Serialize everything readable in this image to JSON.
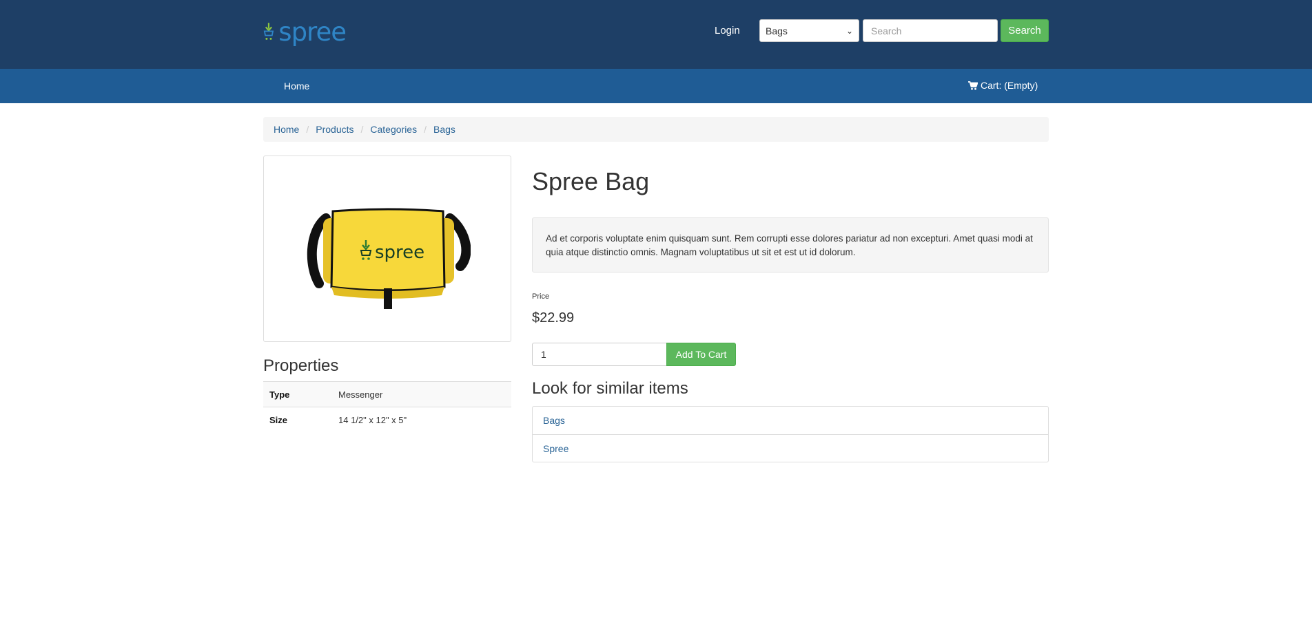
{
  "header": {
    "logo_text": "spree",
    "login_label": "Login",
    "taxon_select_value": "Bags",
    "search_placeholder": "Search",
    "search_button_label": "Search"
  },
  "nav": {
    "home_label": "Home",
    "cart_label": "Cart: (Empty)"
  },
  "breadcrumb": [
    "Home",
    "Products",
    "Categories",
    "Bags"
  ],
  "product": {
    "title": "Spree Bag",
    "description": "Ad et corporis voluptate enim quisquam sunt. Rem corrupti esse dolores pariatur ad non excepturi. Amet quasi modi at quia atque distinctio omnis. Magnam voluptatibus ut sit et est ut id dolorum.",
    "price_label": "Price",
    "price": "$22.99",
    "quantity": "1",
    "add_to_cart_label": "Add To Cart",
    "image_logo_text": "spree"
  },
  "properties": {
    "title": "Properties",
    "rows": [
      {
        "key": "Type",
        "value": "Messenger"
      },
      {
        "key": "Size",
        "value": "14 1/2\" x 12\" x 5\""
      }
    ]
  },
  "similar": {
    "title": "Look for similar items",
    "items": [
      "Bags",
      "Spree"
    ]
  },
  "colors": {
    "header_bg": "#1e3f66",
    "nav_bg": "#1f5c95",
    "accent_green": "#5cb85c",
    "link": "#2a6496",
    "logo_blue": "#2f85c6",
    "logo_green": "#8dc63f",
    "bag_yellow": "#f7d83a"
  },
  "icons": {
    "logo": "spree-logo-icon",
    "cart": "shopping-cart-icon",
    "select": "chevron-down-icon"
  }
}
